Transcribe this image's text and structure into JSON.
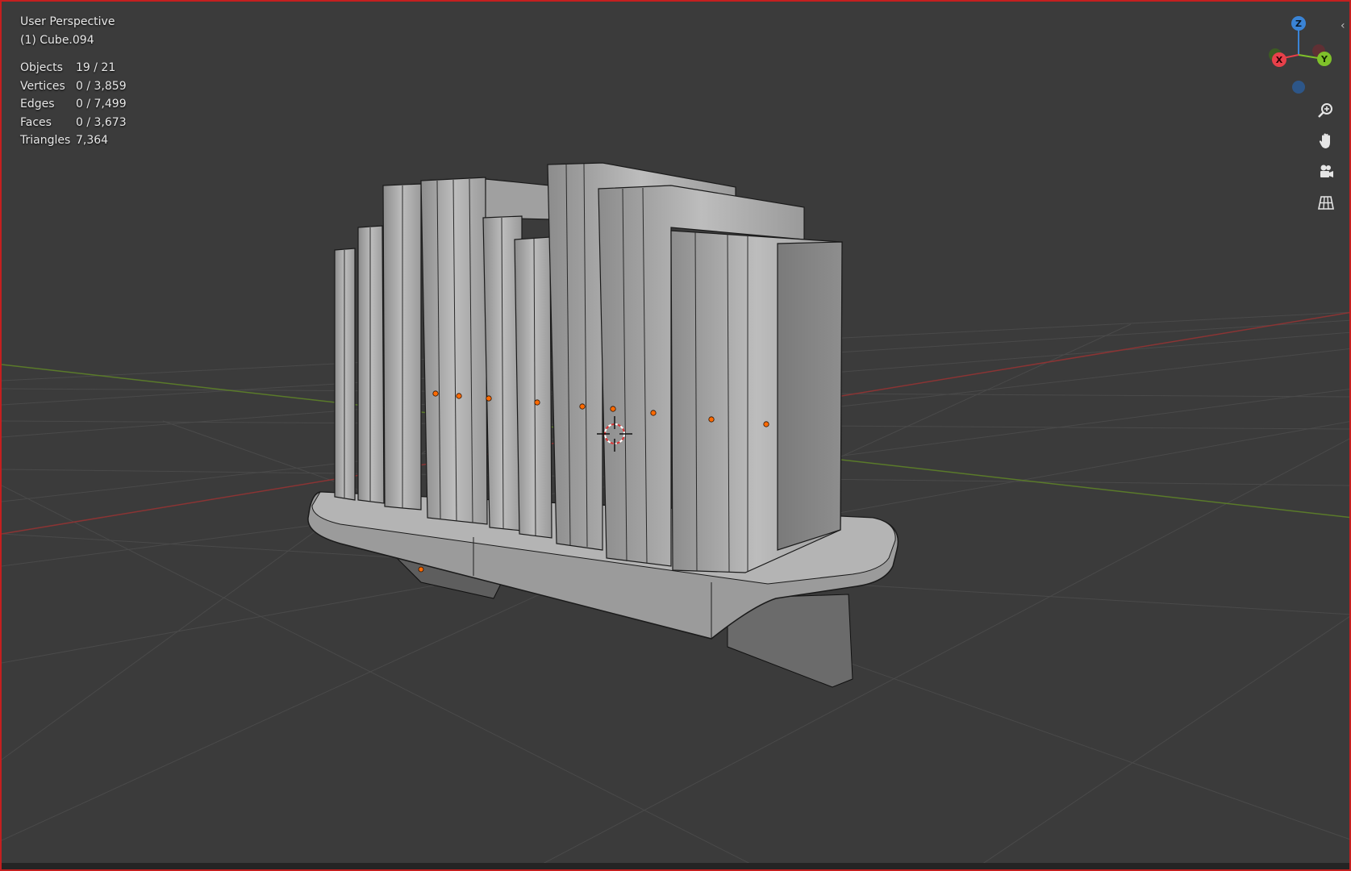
{
  "viewport": {
    "view_name": "User Perspective",
    "active_object": "(1) Cube.094"
  },
  "stats": [
    {
      "label": "Objects",
      "value": "19 / 21"
    },
    {
      "label": "Vertices",
      "value": "0 / 3,859"
    },
    {
      "label": "Edges",
      "value": "0 / 7,499"
    },
    {
      "label": "Faces",
      "value": "0 / 3,673"
    },
    {
      "label": "Triangles",
      "value": "7,364"
    }
  ],
  "gizmo": {
    "z_label": "Z",
    "y_label": "Y",
    "x_label": "X",
    "colors": {
      "x": "#e8404a",
      "y": "#7fc12a",
      "z": "#3a84d6"
    }
  },
  "nav_icons": [
    "zoom-icon",
    "hand-pan-icon",
    "camera-icon",
    "grid-ortho-icon"
  ],
  "accent_colors": {
    "origin_dot": "#ff6a00",
    "viewport_bg": "#3b3b3b",
    "border": "#c41f1f"
  }
}
